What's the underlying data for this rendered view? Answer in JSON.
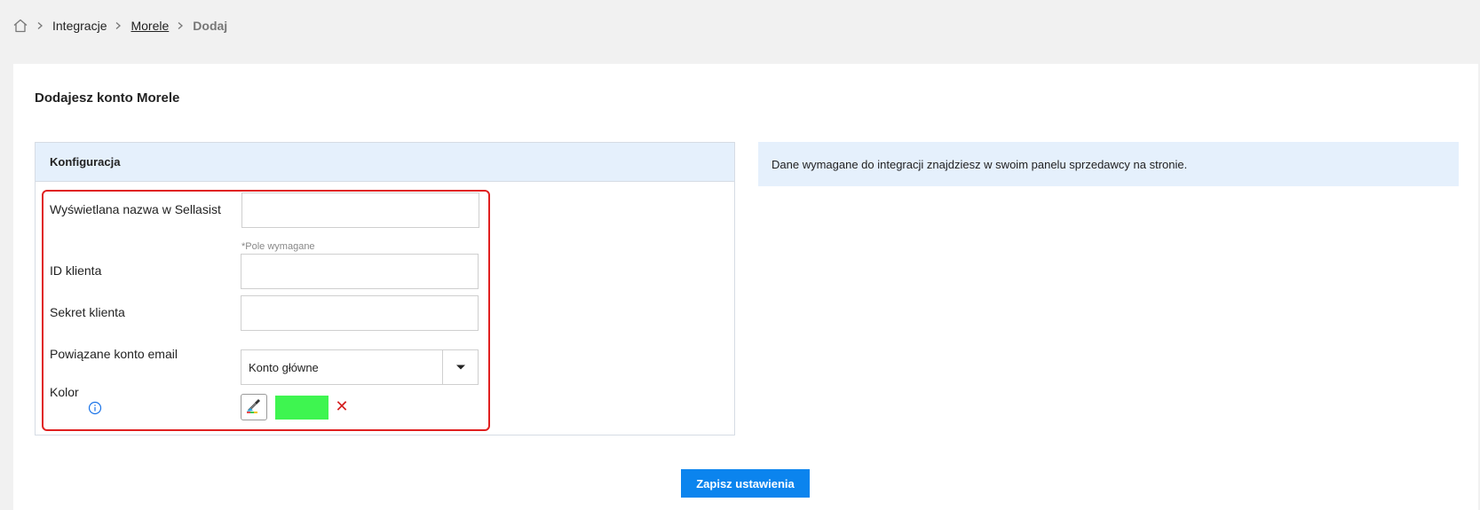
{
  "breadcrumb": {
    "items": [
      "Integracje",
      "Morele",
      "Dodaj"
    ]
  },
  "page": {
    "title": "Dodajesz konto Morele"
  },
  "config": {
    "header": "Konfiguracja",
    "fields": {
      "display_name": {
        "label": "Wyświetlana nazwa w Sellasist",
        "value": "",
        "hint": "*Pole wymagane"
      },
      "client_id": {
        "label": "ID klienta",
        "value": ""
      },
      "client_secret": {
        "label": "Sekret klienta",
        "value": ""
      },
      "email_account": {
        "label": "Powiązane konto email",
        "selected": "Konto główne"
      },
      "color": {
        "label": "Kolor",
        "value": "#3ef550",
        "clear_symbol": "✕"
      }
    }
  },
  "info": {
    "text": "Dane wymagane do integracji znajdziesz w swoim panelu sprzedawcy na stronie."
  },
  "actions": {
    "save_label": "Zapisz ustawienia"
  },
  "colors": {
    "accent": "#0b84ee",
    "panel_header": "#e5f0fc",
    "highlight_frame": "#e02020",
    "swatch": "#3ef550"
  },
  "icons": {
    "home": "home-icon",
    "separator": "chevron-right-icon",
    "info": "info-circle-icon",
    "picker": "eyedropper-icon",
    "dropdown": "caret-down-icon"
  }
}
